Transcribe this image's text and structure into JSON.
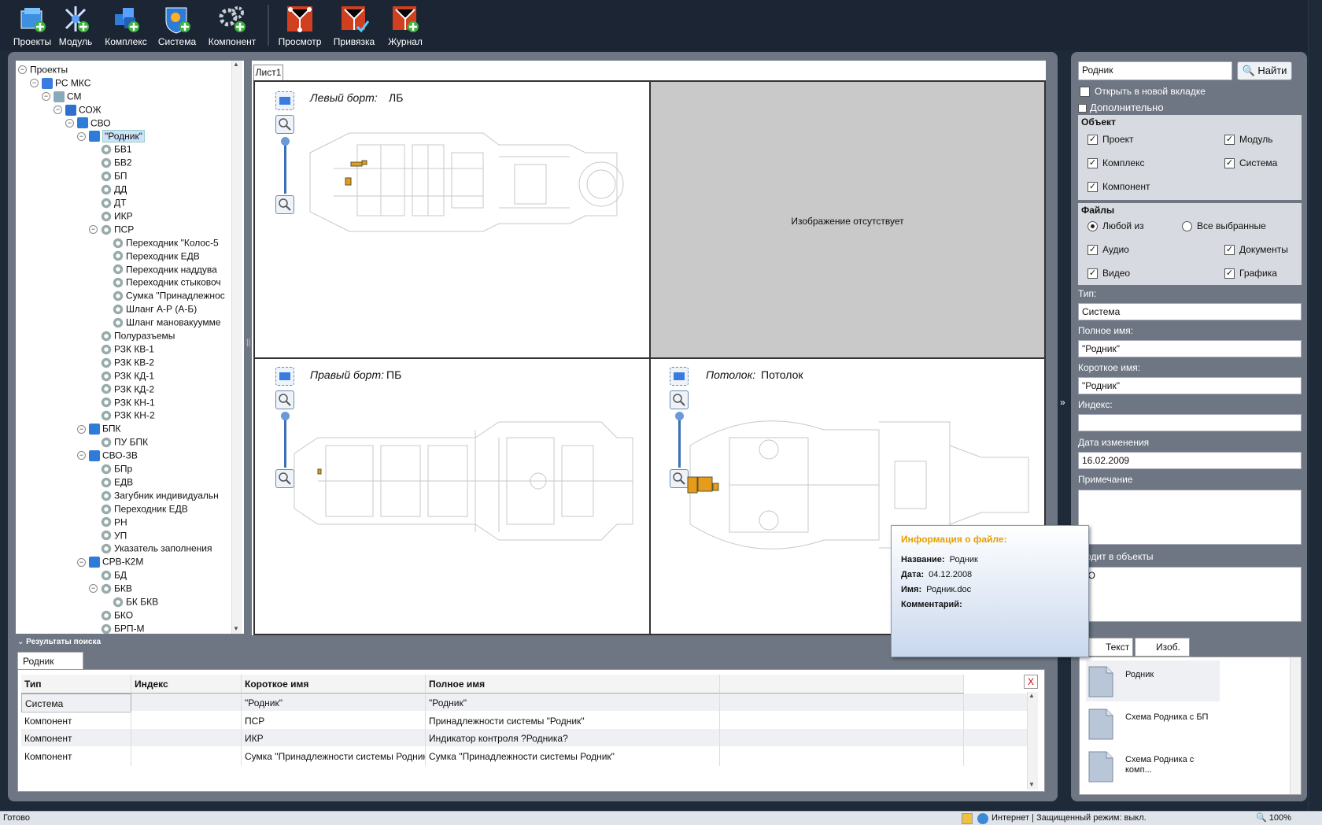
{
  "toolbar": {
    "buttons": [
      {
        "label": "Проекты",
        "icon": "projects-icon"
      },
      {
        "label": "Модуль",
        "icon": "module-icon"
      },
      {
        "label": "Комплекс",
        "icon": "complex-icon"
      },
      {
        "label": "Система",
        "icon": "system-icon"
      },
      {
        "label": "Компонент",
        "icon": "component-icon"
      },
      {
        "label": "Просмотр",
        "icon": "view-icon"
      },
      {
        "label": "Привязка",
        "icon": "binding-icon"
      },
      {
        "label": "Журнал",
        "icon": "journal-icon"
      }
    ]
  },
  "tree": {
    "nodes": [
      {
        "label": "Проекты",
        "toggle": "−"
      },
      {
        "label": "РС МКС",
        "toggle": "−"
      },
      {
        "label": "СМ",
        "toggle": "−"
      },
      {
        "label": "СОЖ",
        "toggle": "−"
      },
      {
        "label": "СВО",
        "toggle": "−"
      },
      {
        "label": "\"Родник\"",
        "toggle": "−"
      },
      {
        "label": "БВ1"
      },
      {
        "label": "БВ2"
      },
      {
        "label": "БП"
      },
      {
        "label": "ДД"
      },
      {
        "label": "ДТ"
      },
      {
        "label": "ИКР"
      },
      {
        "label": "ПСР",
        "toggle": "−"
      },
      {
        "label": "Переходник \"Колос-5"
      },
      {
        "label": "Переходник ЕДВ"
      },
      {
        "label": "Переходник наддува"
      },
      {
        "label": "Переходник стыковоч"
      },
      {
        "label": "Сумка \"Принадлежнос"
      },
      {
        "label": "Шланг А-Р (А-Б)"
      },
      {
        "label": "Шланг мановакуумме"
      },
      {
        "label": "Полуразъемы"
      },
      {
        "label": "РЗК КВ-1"
      },
      {
        "label": "РЗК КВ-2"
      },
      {
        "label": "РЗК КД-1"
      },
      {
        "label": "РЗК КД-2"
      },
      {
        "label": "РЗК КН-1"
      },
      {
        "label": "РЗК КН-2"
      },
      {
        "label": "БПК",
        "toggle": "−"
      },
      {
        "label": "ПУ БПК"
      },
      {
        "label": "СВО-ЗВ",
        "toggle": "−"
      },
      {
        "label": "БПр"
      },
      {
        "label": "ЕДВ"
      },
      {
        "label": "Загубник индивидуальн"
      },
      {
        "label": "Переходник ЕДВ"
      },
      {
        "label": "РН"
      },
      {
        "label": "УП"
      },
      {
        "label": "Указатель заполнения"
      },
      {
        "label": "СРВ-К2М",
        "toggle": "−"
      },
      {
        "label": "БД"
      },
      {
        "label": "БКВ",
        "toggle": "−"
      },
      {
        "label": "БК БКВ"
      },
      {
        "label": "БКО"
      },
      {
        "label": "БРП-М"
      }
    ]
  },
  "sheet": {
    "tab": "Лист1",
    "cells": [
      {
        "label": "Левый борт:",
        "value": "ЛБ"
      },
      {
        "no_image": "Изображение отсутствует"
      },
      {
        "label": "Правый борт:",
        "value": "ПБ"
      },
      {
        "label": "Потолок:",
        "value": "Потолок"
      }
    ]
  },
  "results": {
    "title": "Результаты поиска",
    "tab": "Родник",
    "close": "X",
    "columns": [
      "Тип",
      "Индекс",
      "Короткое имя",
      "Полное имя"
    ],
    "rows": [
      [
        "Система",
        "",
        "\"Родник\"",
        "\"Родник\""
      ],
      [
        "Компонент",
        "",
        "ПСР",
        "Принадлежности системы \"Родник\""
      ],
      [
        "Компонент",
        "",
        "ИКР",
        "Индикатор контроля ?Родника?"
      ],
      [
        "Компонент",
        "",
        "Сумка \"Принадлежности системы Родник\"",
        "Сумка \"Принадлежности системы Родник\""
      ]
    ]
  },
  "search": {
    "query": "Родник",
    "find_label": "Найти",
    "open_new_tab": "Открыть в новой вкладке",
    "advanced": "Дополнительно",
    "object_group": "Объект",
    "objects": [
      {
        "label": "Проект",
        "checked": true
      },
      {
        "label": "Модуль",
        "checked": true
      },
      {
        "label": "Комплекс",
        "checked": true
      },
      {
        "label": "Система",
        "checked": true
      },
      {
        "label": "Компонент",
        "checked": true
      }
    ],
    "files_group": "Файлы",
    "any_of": "Любой из",
    "all_selected": "Все выбранные",
    "file_types": [
      {
        "label": "Аудио",
        "checked": true
      },
      {
        "label": "Документы",
        "checked": true
      },
      {
        "label": "Видео",
        "checked": true
      },
      {
        "label": "Графика",
        "checked": true
      }
    ]
  },
  "props": {
    "type_label": "Тип:",
    "type_value": "Система",
    "fullname_label": "Полное имя:",
    "fullname_value": "\"Родник\"",
    "shortname_label": "Короткое имя:",
    "shortname_value": "\"Родник\"",
    "index_label": "Индекс:",
    "index_value": "",
    "date_label": "Дата изменения",
    "date_value": "16.02.2009",
    "note_label": "Примечание",
    "note_value": "",
    "parents_label": "одит в объекты",
    "parents_value": "ВО"
  },
  "files": {
    "tab_text": "Текст",
    "tab_image": "Изоб.",
    "items": [
      "Родник",
      "Схема Родника с БП",
      "Схема Родника с комп..."
    ]
  },
  "popup": {
    "title": "Информация о файле:",
    "name_label": "Название:",
    "name_value": "Родник",
    "date_label": "Дата:",
    "date_value": "04.12.2008",
    "file_label": "Имя:",
    "file_value": "Родник.doc",
    "comment_label": "Комментарий:"
  },
  "status": {
    "left": "Готово",
    "zone": "Интернет | Защищенный режим: выкл.",
    "zoom": "100%"
  },
  "colors": {
    "accent": "#e8a000",
    "panel": "#6e7683",
    "bg": "#1e2a38"
  }
}
